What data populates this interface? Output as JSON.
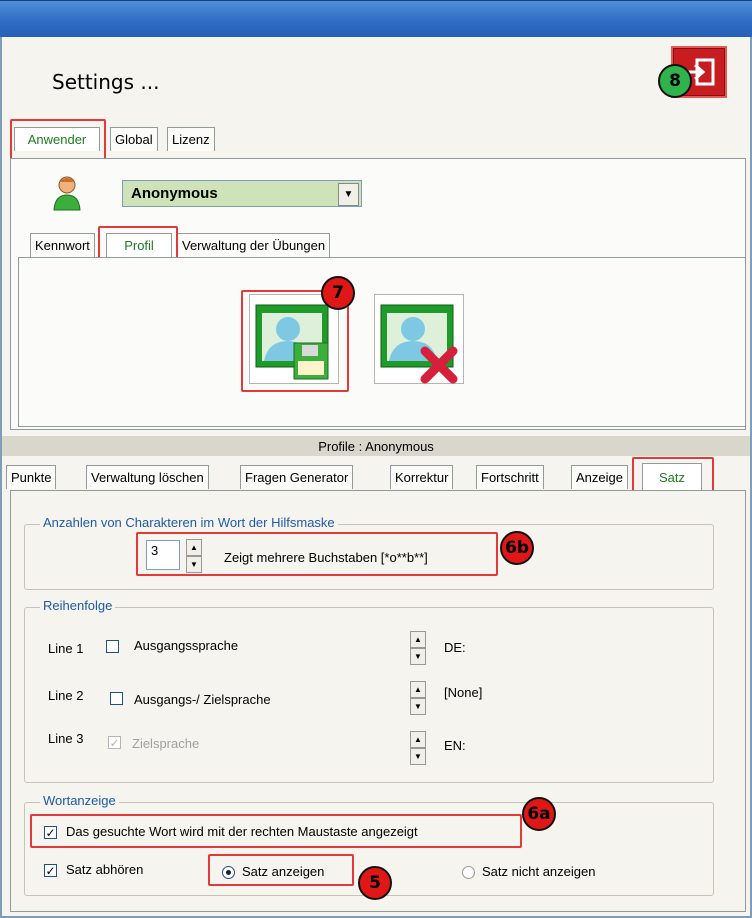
{
  "window": {
    "title": "Settings ..."
  },
  "callouts": {
    "exit": "8",
    "save": "7",
    "hint_count": "6b",
    "right_click": "6a",
    "show_sentence": "5"
  },
  "top_tabs": [
    "Anwender",
    "Global",
    "Lizenz"
  ],
  "user": {
    "selected": "Anonymous"
  },
  "user_tabs": [
    "Kennwort",
    "Profil",
    "Verwaltung der Übungen"
  ],
  "profile_bar": "Profile : Anonymous",
  "profile_tabs": [
    "Punkte",
    "Verwaltung löschen",
    "Fragen Generator",
    "Korrektur",
    "Fortschritt",
    "Anzeige",
    "Satz"
  ],
  "hint_group": {
    "legend": "Anzahlen von Charakteren im Wort der Hilfsmaske",
    "value": "3",
    "description": "Zeigt mehrere Buchstaben [*o**b**]"
  },
  "order_group": {
    "legend": "Reihenfolge",
    "lines": [
      {
        "label": "Line 1",
        "option": "Ausgangssprache",
        "checked": false,
        "disabled": false,
        "lang": "DE:"
      },
      {
        "label": "Line 2",
        "option": "Ausgangs-/ Zielsprache",
        "checked": false,
        "disabled": false,
        "lang": "[None]"
      },
      {
        "label": "Line 3",
        "option": "Zielsprache",
        "checked": true,
        "disabled": true,
        "lang": "EN:"
      }
    ]
  },
  "word_group": {
    "legend": "Wortanzeige",
    "right_click": "Das gesuchte Wort wird mit der rechten Maustaste angezeigt",
    "listen": "Satz abhören",
    "show": "Satz anzeigen",
    "hide": "Satz nicht anzeigen"
  },
  "colors": {
    "accent_red": "#e23a3a",
    "callout_green": "#2fb34a",
    "callout_red": "#e01717",
    "active_tab": "#1f7a1f",
    "legend": "#1e5aa8"
  }
}
